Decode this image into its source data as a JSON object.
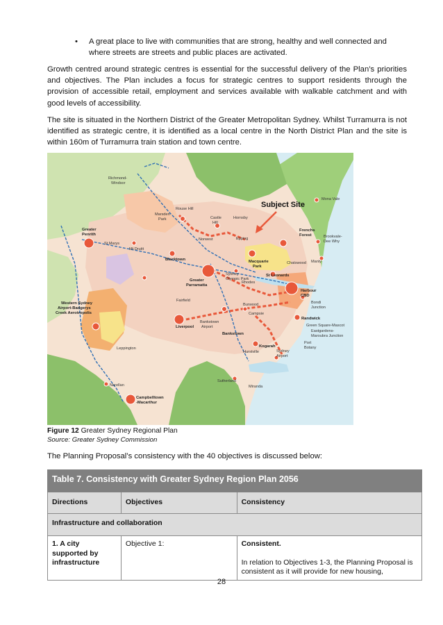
{
  "bullet": {
    "symbol": "•",
    "text": "A great place to live with communities that are strong, healthy and well connected and where streets are streets and public places are activated."
  },
  "paragraphs": {
    "p1": "Growth centred around strategic centres is essential for the successful delivery of the Plan’s priorities and objectives. The Plan includes a focus for strategic centres to support residents through the provision of accessible retail, employment and services available with walkable catchment and with good levels of accessibility.",
    "p2": "The site is situated in the Northern District of the Greater Metropolitan Sydney. Whilst Turramurra is not identified as strategic centre, it is identified as a local centre in the North District Plan and the site is within 160m of Turramurra train station and town centre."
  },
  "map": {
    "subject_label": "Subject Site",
    "labels": {
      "richmond": "Richmond-",
      "windsor": "Windsor",
      "rouse_hill": "Rouse Hill",
      "marsden1": "Marsden",
      "marsden2": "Park",
      "castle1": "Castle",
      "castle2": "Hill",
      "hornsby": "Hornsby",
      "norwest": "Norwest",
      "penrith1": "Greater",
      "penrith2": "Penrith",
      "st_marys": "St Marys",
      "mt_druitt": "Mt Druitt",
      "blacktown": "Blacktown",
      "parramatta1": "Greater",
      "parramatta2": "Parramatta",
      "epping": "Epping",
      "macquarie1": "Macquarie",
      "macquarie2": "Park",
      "chatswood": "Chatswood",
      "frenchs1": "Frenchs",
      "frenchs2": "Forest",
      "mona_vale": "Mona Vale",
      "brookvale1": "Brookvale-",
      "brookvale2": "Dee Why",
      "manly": "Manly",
      "st_leonards": "St Leonards",
      "harbour1": "Harbour",
      "harbour2": "CBD",
      "sydney_olympic1": "Sydney",
      "sydney_olympic2": "Olympic Park",
      "rhodes": "Rhodes",
      "burwood": "Burwood",
      "fairfield": "Fairfield",
      "liverpool": "Liverpool",
      "bankstown_airport1": "Bankstown",
      "bankstown_airport2": "Airport",
      "bankstown": "Bankstown",
      "campsie": "Campsie",
      "bondi1": "Bondi",
      "bondi2": "Junction",
      "randwick": "Randwick",
      "green_square": "Green Square-Mascot",
      "eastgardens1": "Eastgardens-",
      "eastgardens2": "Maroubra Junction",
      "port_botany1": "Port",
      "port_botany2": "Botany",
      "kogarah": "Kogarah",
      "hurstville": "Hurstville",
      "sydney_airport1": "Sydney",
      "sydney_airport2": "Airport",
      "aerotropolis1": "Western Sydney",
      "aerotropolis2": "Airport-Badgerys",
      "aerotropolis3": "Creek Aerotropolis",
      "leppington": "Leppington",
      "narellan": "Narellan",
      "campbelltown1": "Campbelltown",
      "campbelltown2": "-Macarthur",
      "sutherland": "Sutherland",
      "miranda": "Miranda"
    },
    "colors": {
      "water": "#d7ecf3",
      "urban": "#f3d2c0",
      "green": "#8cc06a",
      "light_green": "#cfe3b0",
      "centre": "#e8583a",
      "rail": "#2f6fb5"
    }
  },
  "figure": {
    "number": "Figure 12",
    "caption": "Greater Sydney Regional Plan",
    "source": "Source: Greater Sydney Commission"
  },
  "intro": "The Planning Proposal’s consistency with the 40 objectives is discussed below:",
  "table": {
    "title": "Table 7. Consistency with Greater Sydney Region Plan 2056",
    "headers": [
      "Directions",
      "Objectives",
      "Consistency"
    ],
    "group": "Infrastructure and collaboration",
    "row": {
      "direction": "1. A city supported by infrastructure",
      "objective": "Objective 1:",
      "consistency_title": "Consistent.",
      "consistency_text": "In relation to Objectives 1-3, the Planning Proposal is consistent as it will provide for new housing,"
    }
  },
  "page_number": "28"
}
